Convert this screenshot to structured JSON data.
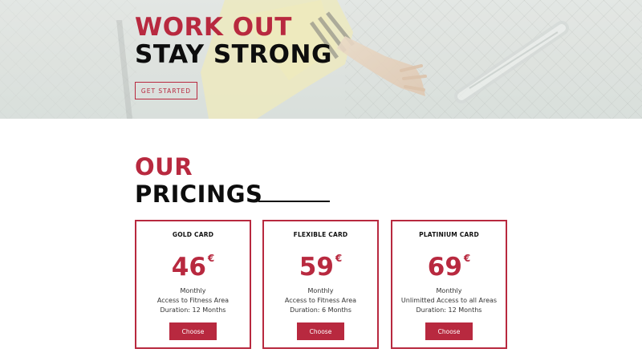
{
  "hero": {
    "title_line1": "WORK OUT",
    "title_line2": "STAY STRONG",
    "cta_label": "GET STARTED"
  },
  "pricing_section": {
    "title_line1": "OUR",
    "title_line2": "PRICINGS"
  },
  "plans": [
    {
      "name": "GOLD CARD",
      "price": "46",
      "currency": "€",
      "period": "Monthly",
      "access": "Access to Fitness Area",
      "duration": "Duration: 12 Months",
      "button_label": "Choose"
    },
    {
      "name": "FLEXIBLE CARD",
      "price": "59",
      "currency": "€",
      "period": "Monthly",
      "access": "Access to Fitness Area",
      "duration": "Duration: 6 Months",
      "button_label": "Choose"
    },
    {
      "name": "PLATINIUM CARD",
      "price": "69",
      "currency": "€",
      "period": "Monthly",
      "access": "Unlimitted Access to all Areas",
      "duration": "Duration: 12 Months",
      "button_label": "Choose"
    }
  ],
  "colors": {
    "accent": "#b8293f",
    "heading_dark": "#0d0d0d",
    "hero_background": "#d7dcd8"
  }
}
